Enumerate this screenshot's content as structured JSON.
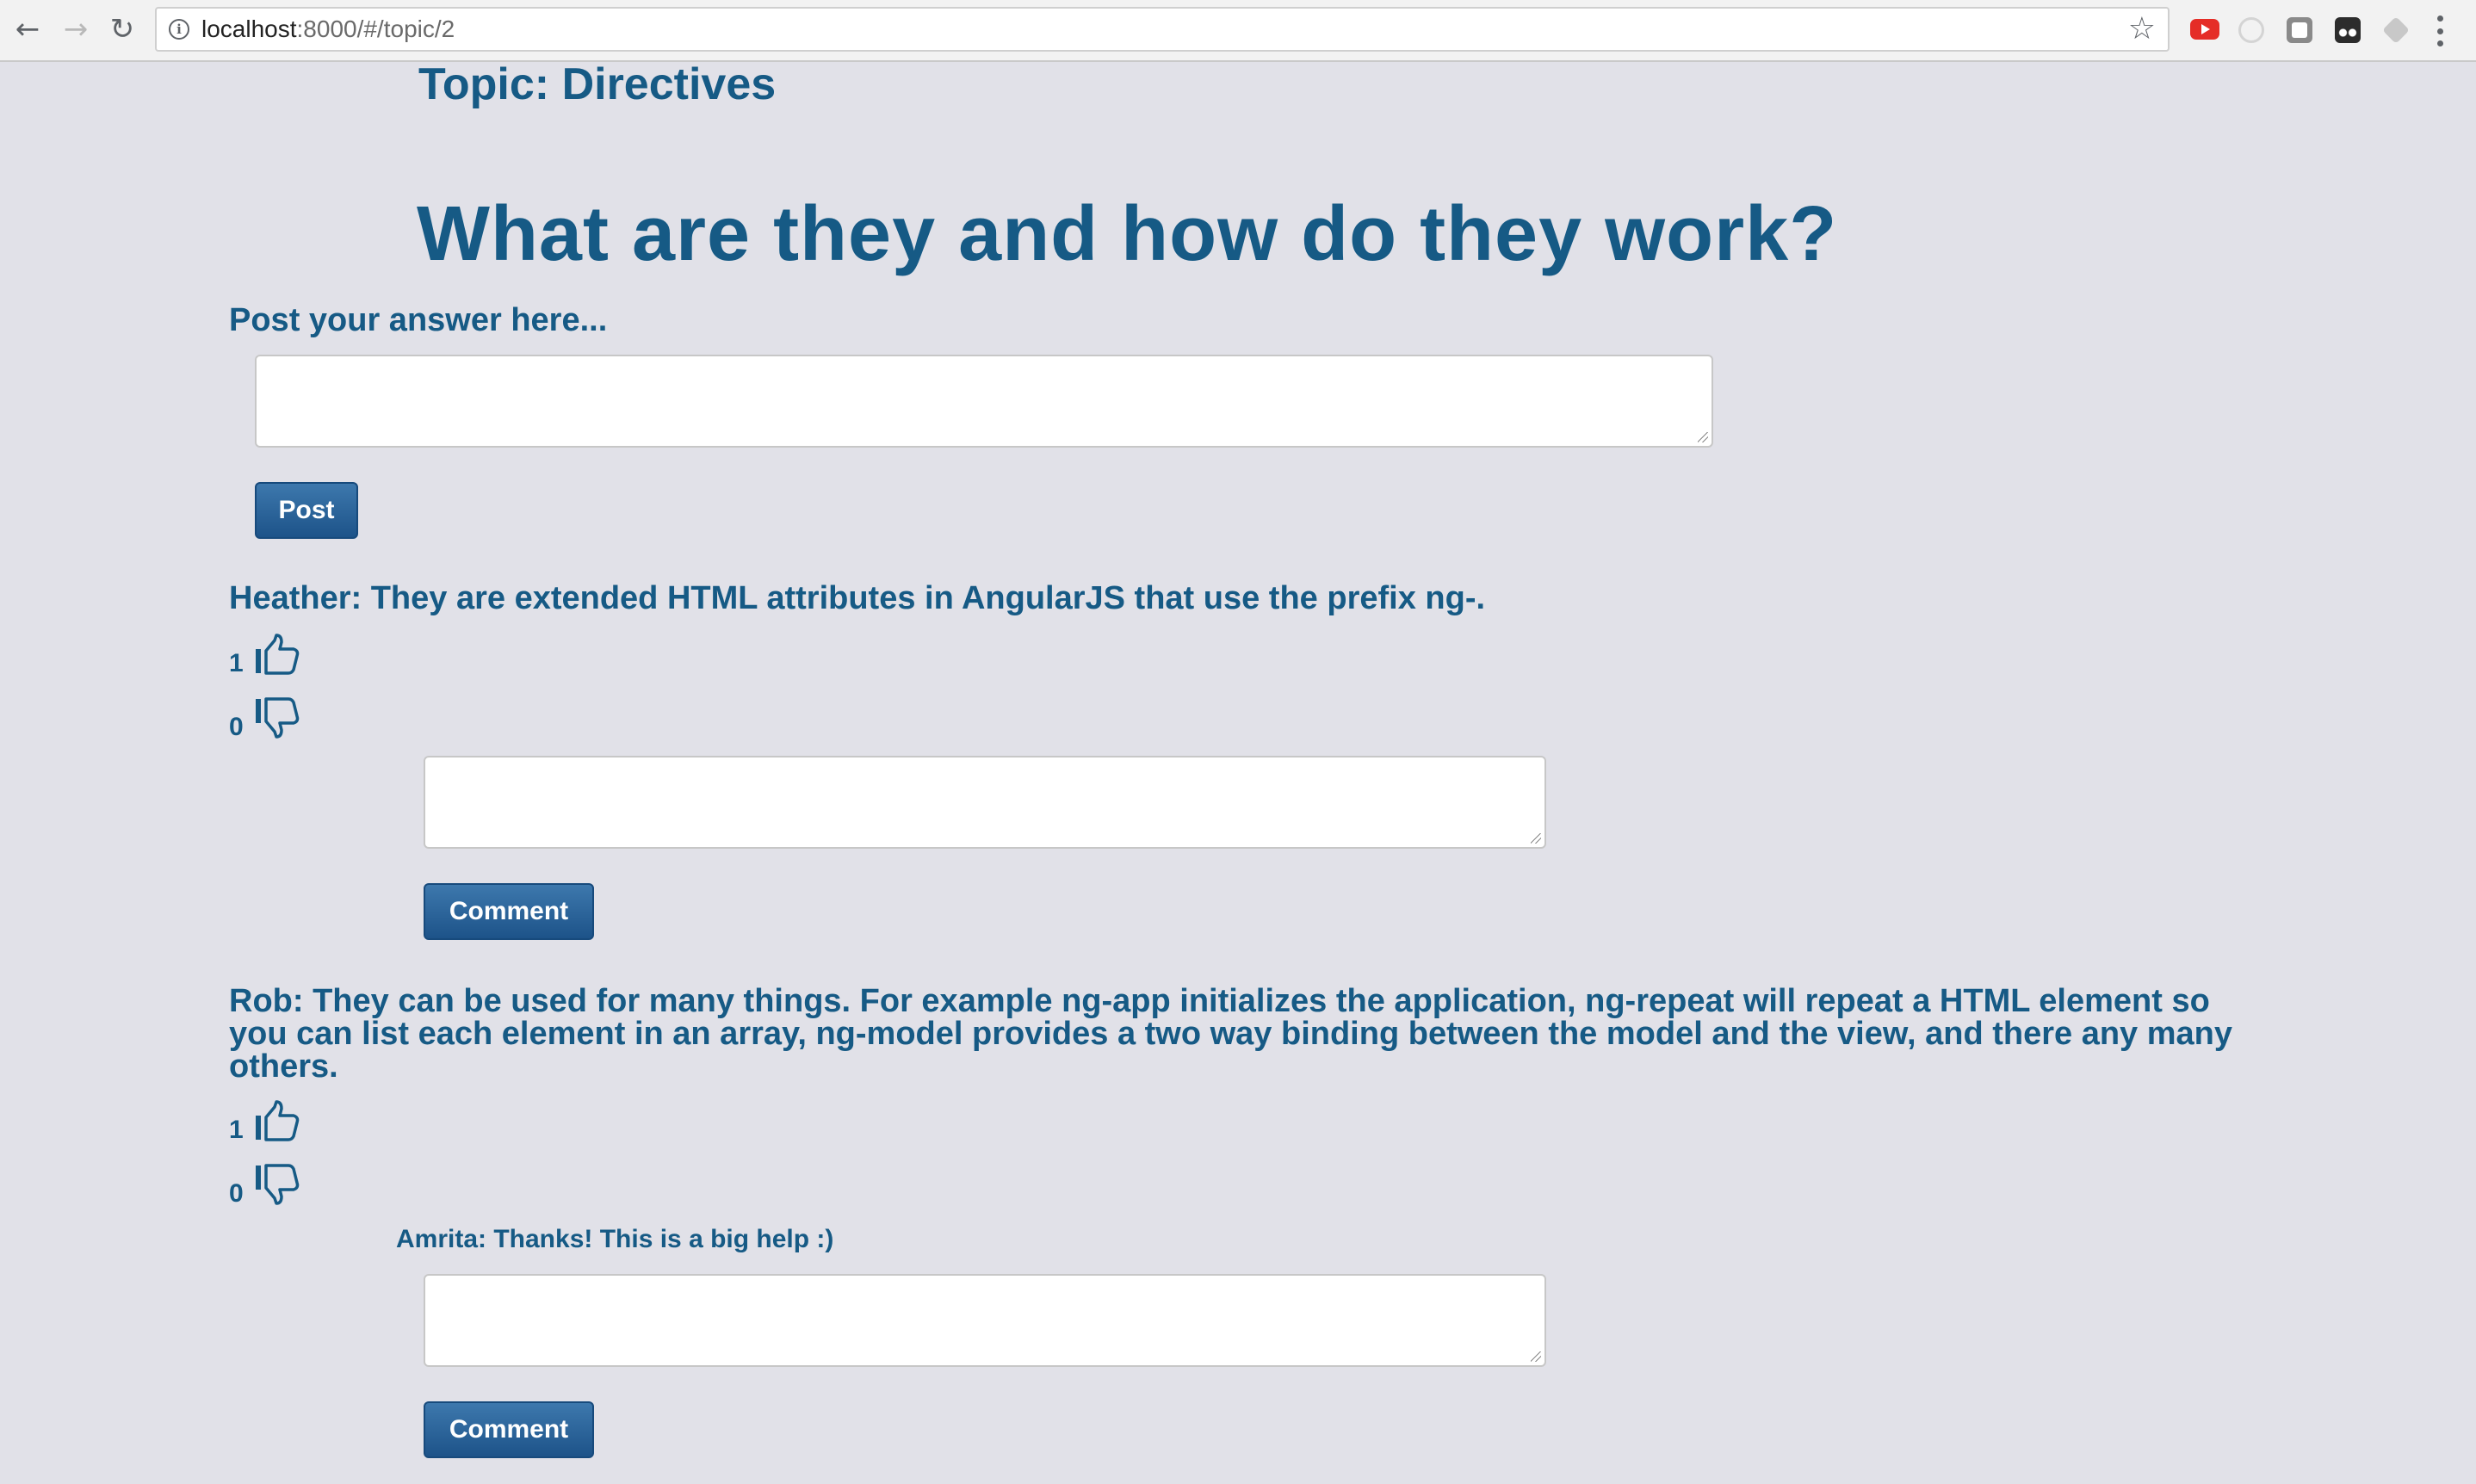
{
  "browser": {
    "url_host": "localhost",
    "url_rest": ":8000/#/topic/2"
  },
  "page": {
    "topic_title": "Topic: Directives",
    "question": "What are they and how do they work?",
    "post_label": "Post your answer here...",
    "post_button": "Post",
    "answers": [
      {
        "text": "Heather: They are extended HTML attributes in AngularJS that use the prefix ng-.",
        "likes": "1",
        "dislikes": "0",
        "comments": [],
        "comment_button": "Comment"
      },
      {
        "text": "Rob: They can be used for many things. For example ng-app initializes the application, ng-repeat will repeat a HTML element so you can list each element in an array, ng-model provides a two way binding between the model and the view, and there any many others.",
        "likes": "1",
        "dislikes": "0",
        "comments": [
          "Amrita: Thanks! This is a big help :)"
        ],
        "comment_button": "Comment"
      }
    ]
  },
  "colors": {
    "background": "#e1e1e8",
    "heading": "#165a85",
    "button": "#2a6399"
  }
}
